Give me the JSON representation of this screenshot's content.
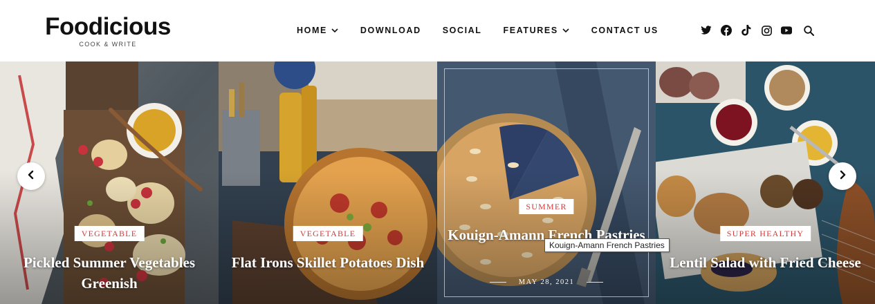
{
  "brand": {
    "name": "Foodicious",
    "tagline": "COOK & WRITE"
  },
  "nav": [
    {
      "label": "HOME",
      "has_dropdown": true
    },
    {
      "label": "DOWNLOAD",
      "has_dropdown": false
    },
    {
      "label": "SOCIAL",
      "has_dropdown": false
    },
    {
      "label": "FEATURES",
      "has_dropdown": true
    },
    {
      "label": "CONTACT US",
      "has_dropdown": false
    }
  ],
  "social_icons": [
    "twitter-icon",
    "facebook-icon",
    "tiktok-icon",
    "instagram-icon",
    "youtube-icon",
    "search-icon"
  ],
  "slides": [
    {
      "category": "VEGETABLE",
      "title": "Pickled Summer Vegetables Greenish"
    },
    {
      "category": "VEGETABLE",
      "title": "Flat Irons Skillet Potatoes Dish"
    },
    {
      "category": "SUMMER",
      "title": "Kouign-Amann French Pastries",
      "date": "MAY 28, 2021"
    },
    {
      "category": "SUPER HEALTHY",
      "title": "Lentil Salad with Fried Cheese"
    }
  ],
  "tooltip": "Kouign-Amann French Pastries",
  "colors": {
    "accent": "#d43a3a",
    "text": "#111111",
    "header_bg": "#ffffff"
  }
}
